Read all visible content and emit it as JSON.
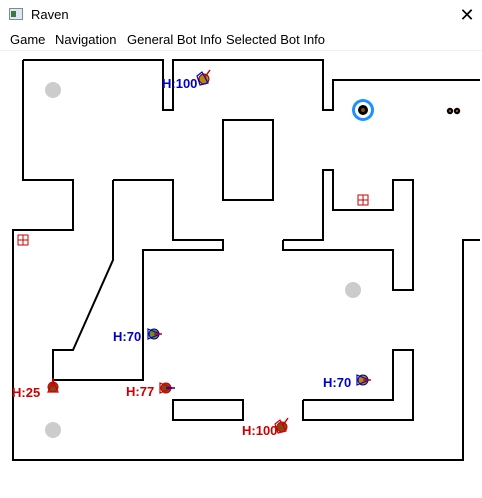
{
  "window": {
    "title": "Raven",
    "close_glyph": "✕"
  },
  "menu": {
    "items": [
      {
        "label": "Game"
      },
      {
        "label": "Navigation"
      },
      {
        "label": "General Bot Info"
      },
      {
        "label": "Selected Bot Info"
      }
    ]
  },
  "colors": {
    "wall": "#000000",
    "spawn_point": "#cccccc",
    "friendly_label": "#0000cc",
    "enemy_label": "#cc0000",
    "goal_ring": "#1e90ff"
  },
  "bots": [
    {
      "label": "H:100",
      "team": "blue",
      "facing": "up-right"
    },
    {
      "label": "H:70",
      "team": "blue",
      "facing": "right"
    },
    {
      "label": "H:70",
      "team": "blue",
      "facing": "right"
    },
    {
      "label": "H:25",
      "team": "red",
      "facing": "up"
    },
    {
      "label": "H:77",
      "team": "red",
      "facing": "right"
    },
    {
      "label": "H:100",
      "team": "red",
      "facing": "up-right"
    }
  ],
  "items": [
    {
      "type": "health-pack-icon"
    },
    {
      "type": "health-pack-icon"
    },
    {
      "type": "shotgun-pickup-icon"
    },
    {
      "type": "goal-ring-icon"
    }
  ]
}
